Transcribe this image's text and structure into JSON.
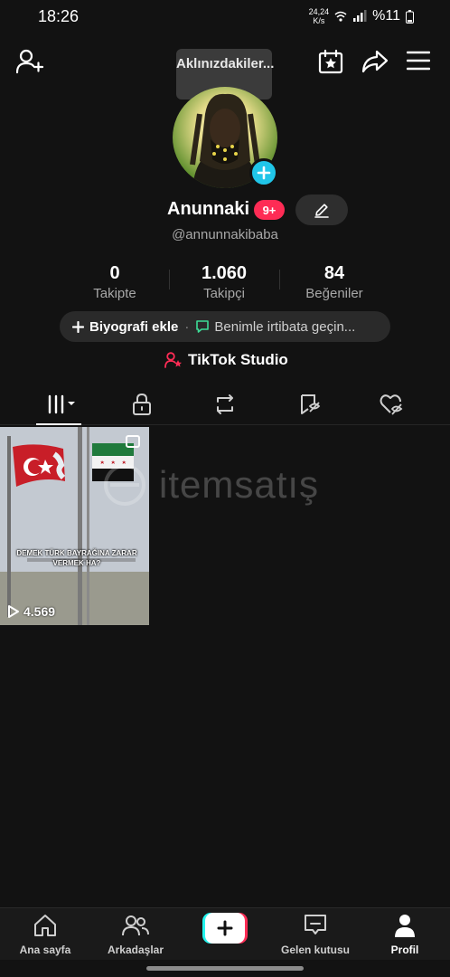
{
  "status_bar": {
    "time": "18:26",
    "net_speed_top": "24,24",
    "net_speed_bottom": "K/s",
    "battery": "%11"
  },
  "header": {
    "tooltip": "Aklınızdakiler..."
  },
  "profile": {
    "name": "Anunnaki",
    "notification_badge": "9+",
    "handle": "@annunnakibaba"
  },
  "stats": [
    {
      "value": "0",
      "label": "Takipte"
    },
    {
      "value": "1.060",
      "label": "Takipçi"
    },
    {
      "value": "84",
      "label": "Beğeniler"
    }
  ],
  "bio": {
    "add_bio_label": "Biyografi ekle",
    "separator": "·",
    "contact_label": "Benimle irtibata geçin..."
  },
  "studio_label": "TikTok Studio",
  "tabs": [
    {
      "icon": "grid-icon"
    },
    {
      "icon": "lock-icon"
    },
    {
      "icon": "repost-icon"
    },
    {
      "icon": "bookmark-icon"
    },
    {
      "icon": "liked-icon"
    }
  ],
  "videos": [
    {
      "caption": "DEMEK TÜRK BAYRAĞINA ZARAR VERMEK HA?",
      "views": "4.569"
    }
  ],
  "watermark": "itemsatış",
  "colors": {
    "accent": "#fe2c55",
    "cyan": "#25f4ee",
    "avatar_add": "#20c5e8",
    "contact_icon": "#3ddc97"
  },
  "bottom_nav": {
    "home": "Ana sayfa",
    "friends": "Arkadaşlar",
    "inbox": "Gelen kutusu",
    "profile": "Profil"
  }
}
